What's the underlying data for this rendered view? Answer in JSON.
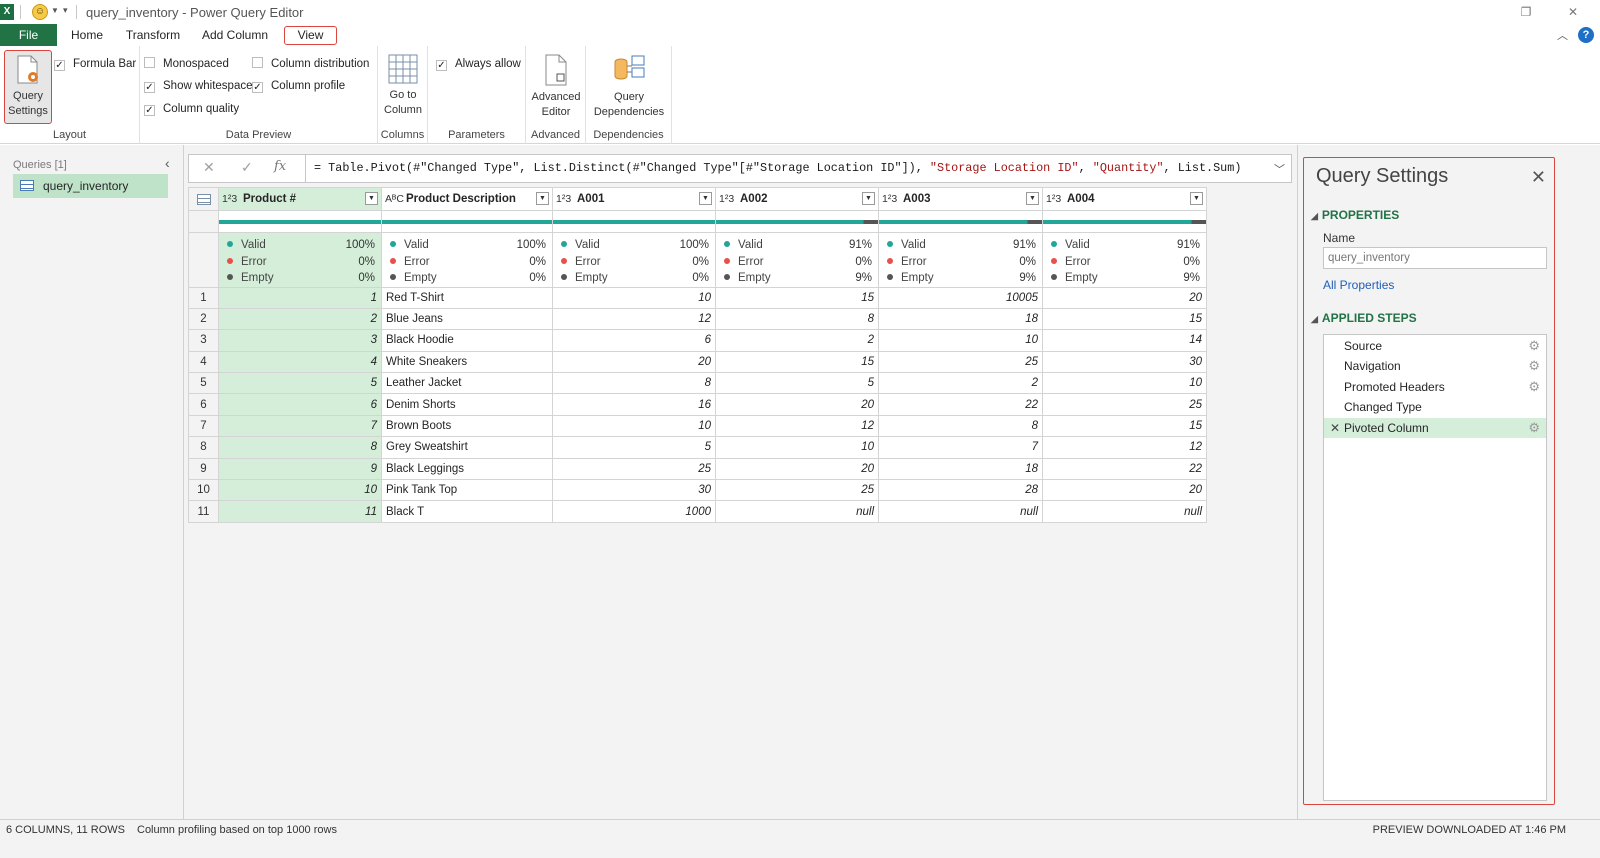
{
  "window": {
    "app_icon": "X",
    "title": "query_inventory - Power Query Editor",
    "restore_glyph": "❐",
    "close_glyph": "✕"
  },
  "tabs": [
    {
      "label": "File"
    },
    {
      "label": "Home"
    },
    {
      "label": "Transform"
    },
    {
      "label": "Add Column"
    },
    {
      "label": "View"
    }
  ],
  "ribbon": {
    "layout": {
      "query_settings_line1": "Query",
      "query_settings_line2": "Settings",
      "formula_bar": "Formula Bar",
      "group": "Layout"
    },
    "data_preview": {
      "monospaced": "Monospaced",
      "show_whitespace": "Show whitespace",
      "column_quality": "Column quality",
      "column_distribution": "Column distribution",
      "column_profile": "Column profile",
      "group": "Data Preview"
    },
    "columns": {
      "line1": "Go to",
      "line2": "Column",
      "group": "Columns"
    },
    "parameters": {
      "always_allow": "Always allow",
      "group": "Parameters"
    },
    "advanced": {
      "line1": "Advanced",
      "line2": "Editor",
      "group": "Advanced"
    },
    "dependencies": {
      "line1": "Query",
      "line2": "Dependencies",
      "group": "Dependencies"
    },
    "checked": {
      "formula_bar": true,
      "monospaced": false,
      "show_whitespace": true,
      "column_quality": true,
      "column_distribution": false,
      "column_profile": true,
      "always_allow": true
    }
  },
  "queries": {
    "header": "Queries [1]",
    "items": [
      {
        "label": "query_inventory"
      }
    ]
  },
  "formula": {
    "prefix": "= Table.Pivot(#\"Changed Type\", List.Distinct(#\"Changed Type\"[#\"Storage Location ID\"]), ",
    "str1": "\"Storage Location ID\"",
    "mid": ", ",
    "str2": "\"Quantity\"",
    "suffix": ", List.Sum)"
  },
  "grid": {
    "columns": [
      {
        "type": "1²3",
        "name": "Product #",
        "valid": "100%",
        "error": "0%",
        "empty": "0%"
      },
      {
        "type": "AᴮC",
        "name": "Product Description",
        "valid": "100%",
        "error": "0%",
        "empty": "0%"
      },
      {
        "type": "1²3",
        "name": "A001",
        "valid": "100%",
        "error": "0%",
        "empty": "0%"
      },
      {
        "type": "1²3",
        "name": "A002",
        "valid": "91%",
        "error": "0%",
        "empty": "9%"
      },
      {
        "type": "1²3",
        "name": "A003",
        "valid": "91%",
        "error": "0%",
        "empty": "9%"
      },
      {
        "type": "1²3",
        "name": "A004",
        "valid": "91%",
        "error": "0%",
        "empty": "9%"
      }
    ],
    "profile_labels": {
      "valid": "Valid",
      "error": "Error",
      "empty": "Empty"
    },
    "rows": [
      [
        "1",
        "1",
        "Red T-Shirt",
        "10",
        "15",
        "10005",
        "20"
      ],
      [
        "2",
        "2",
        "Blue Jeans",
        "12",
        "8",
        "18",
        "15"
      ],
      [
        "3",
        "3",
        "Black Hoodie",
        "6",
        "2",
        "10",
        "14"
      ],
      [
        "4",
        "4",
        "White Sneakers",
        "20",
        "15",
        "25",
        "30"
      ],
      [
        "5",
        "5",
        "Leather Jacket",
        "8",
        "5",
        "2",
        "10"
      ],
      [
        "6",
        "6",
        "Denim Shorts",
        "16",
        "20",
        "22",
        "25"
      ],
      [
        "7",
        "7",
        "Brown Boots",
        "10",
        "12",
        "8",
        "15"
      ],
      [
        "8",
        "8",
        "Grey Sweatshirt",
        "5",
        "10",
        "7",
        "12"
      ],
      [
        "9",
        "9",
        "Black Leggings",
        "25",
        "20",
        "18",
        "22"
      ],
      [
        "10",
        "10",
        "Pink Tank Top",
        "30",
        "25",
        "28",
        "20"
      ],
      [
        "11",
        "11",
        "Black T",
        "1000",
        "null",
        "null",
        "null"
      ]
    ]
  },
  "query_settings": {
    "title": "Query Settings",
    "properties_header": "PROPERTIES",
    "name_label": "Name",
    "name_value": "query_inventory",
    "all_properties": "All Properties",
    "steps_header": "APPLIED STEPS",
    "steps": [
      {
        "label": "Source",
        "gear": true,
        "active": false
      },
      {
        "label": "Navigation",
        "gear": true,
        "active": false
      },
      {
        "label": "Promoted Headers",
        "gear": true,
        "active": false
      },
      {
        "label": "Changed Type",
        "gear": false,
        "active": false
      },
      {
        "label": "Pivoted Column",
        "gear": true,
        "active": true
      }
    ]
  },
  "status": {
    "summary": "6 COLUMNS, 11 ROWS",
    "profiling": "Column profiling based on top 1000 rows",
    "downloaded": "PREVIEW DOWNLOADED AT 1:46 PM"
  },
  "colors": {
    "accent": "#217346",
    "selected": "#d5eeda",
    "highlight_border": "#d9463e",
    "valid": "#21a698",
    "error": "#e8504c"
  }
}
